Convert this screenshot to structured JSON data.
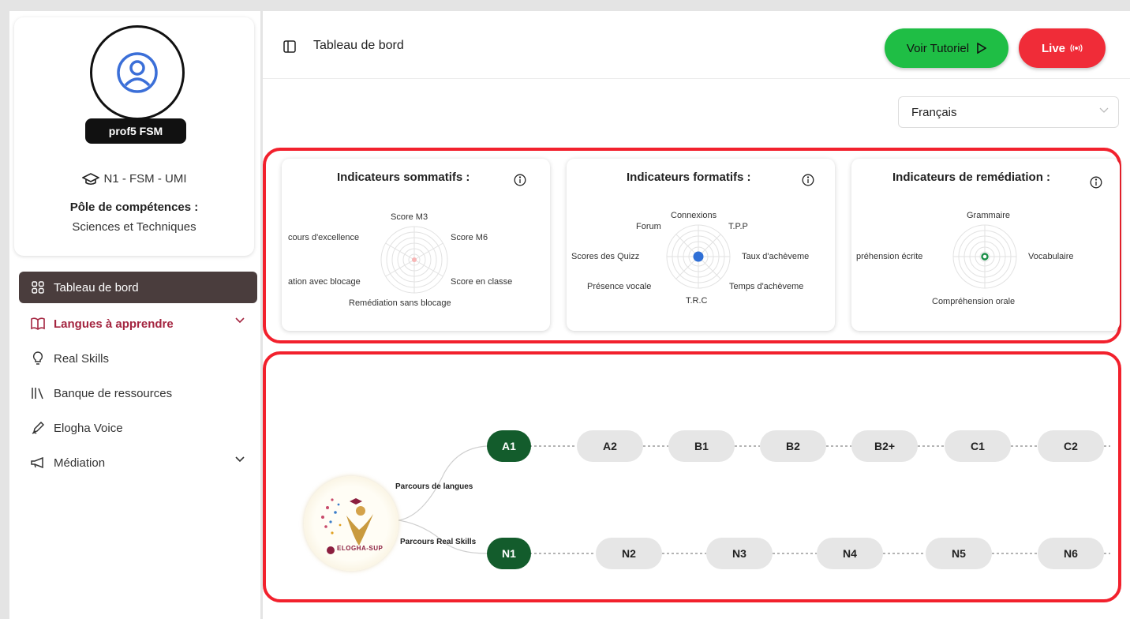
{
  "profile": {
    "name": "prof5 FSM",
    "institution": "N1 - FSM - UMI",
    "pole_title": "Pôle de compétences :",
    "pole_value": "Sciences et Techniques"
  },
  "nav": {
    "items": [
      {
        "label": "Tableau de bord",
        "icon": "grid-icon"
      },
      {
        "label": "Langues à apprendre",
        "icon": "book-open-icon"
      },
      {
        "label": "Real Skills",
        "icon": "lightbulb-icon"
      },
      {
        "label": "Banque de ressources",
        "icon": "library-icon"
      },
      {
        "label": "Elogha Voice",
        "icon": "pen-icon"
      },
      {
        "label": "Médiation",
        "icon": "megaphone-icon"
      }
    ]
  },
  "header": {
    "title": "Tableau de bord",
    "tutorial_label": "Voir Tutoriel",
    "live_label": "Live"
  },
  "language": {
    "selected": "Français"
  },
  "indicators": [
    {
      "title": "Indicateurs sommatifs :",
      "labels": [
        "Score M3",
        "Score M6",
        "Score en classe",
        "Remédiation sans blocage",
        "ation avec blocage",
        "cours d'excellence"
      ]
    },
    {
      "title": "Indicateurs formatifs :",
      "labels": [
        "Connexions",
        "T.P.P",
        "Taux d'achèveme",
        "Temps d'achèveme",
        "T.R.C",
        "Présence vocale",
        "Scores des Quizz",
        "Forum"
      ]
    },
    {
      "title": "Indicateurs de remédiation :",
      "labels": [
        "Grammaire",
        "Vocabulaire",
        "Compréhension orale",
        "préhension écrite"
      ]
    }
  ],
  "roadmap": {
    "language_label": "Parcours de langues",
    "skills_label": "Parcours Real Skills",
    "logo_text": "ELOGHA-SUP",
    "language_levels": [
      "A1",
      "A2",
      "B1",
      "B2",
      "B2+",
      "C1",
      "C2"
    ],
    "skill_levels": [
      "N1",
      "N2",
      "N3",
      "N4",
      "N5",
      "N6"
    ],
    "completed_language": "A1",
    "completed_skill": "N1"
  },
  "colors": {
    "accent_green": "#1fbe45",
    "live_red": "#f02c38",
    "highlight_red": "#f2212d",
    "done_node": "#135c2c",
    "nav_active": "#4a3d3d",
    "nav_accent": "#a42540"
  }
}
